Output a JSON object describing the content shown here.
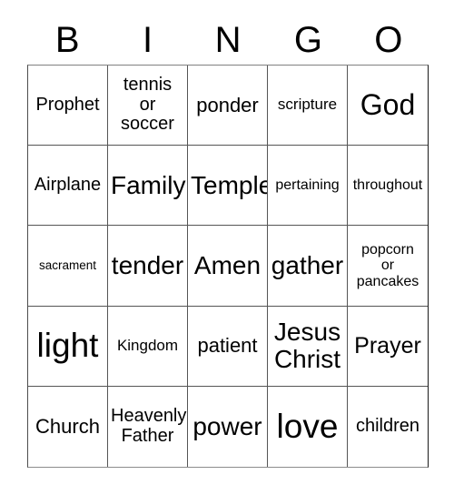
{
  "card": {
    "title_letters": [
      "B",
      "I",
      "N",
      "G",
      "O"
    ],
    "columns": 5,
    "rows": 5,
    "cells": [
      {
        "text": "Prophet",
        "size": "sz-md"
      },
      {
        "text": "tennis\nor\nsoccer",
        "size": "sz-md"
      },
      {
        "text": "ponder",
        "size": "sz-mdl"
      },
      {
        "text": "scripture",
        "size": "sz-smm"
      },
      {
        "text": "God",
        "size": "sz-xxl"
      },
      {
        "text": "Airplane",
        "size": "sz-md"
      },
      {
        "text": "Family",
        "size": "sz-xl"
      },
      {
        "text": "Temple",
        "size": "sz-xl"
      },
      {
        "text": "pertaining",
        "size": "sz-sm"
      },
      {
        "text": "throughout",
        "size": "sz-sm"
      },
      {
        "text": "sacrament",
        "size": "sz-xs"
      },
      {
        "text": "tender",
        "size": "sz-xl"
      },
      {
        "text": "Amen",
        "size": "sz-xl"
      },
      {
        "text": "gather",
        "size": "sz-xl"
      },
      {
        "text": "popcorn\nor\npancakes",
        "size": "sz-sm"
      },
      {
        "text": "light",
        "size": "sz-huge"
      },
      {
        "text": "Kingdom",
        "size": "sz-smm"
      },
      {
        "text": "patient",
        "size": "sz-mdl"
      },
      {
        "text": "Jesus\nChrist",
        "size": "sz-xl"
      },
      {
        "text": "Prayer",
        "size": "sz-lg"
      },
      {
        "text": "Church",
        "size": "sz-mdl"
      },
      {
        "text": "Heavenly\nFather",
        "size": "sz-md"
      },
      {
        "text": "power",
        "size": "sz-xl"
      },
      {
        "text": "love",
        "size": "sz-huge"
      },
      {
        "text": "children",
        "size": "sz-md"
      }
    ]
  },
  "colors": {
    "background": "#ffffff",
    "text": "#000000",
    "grid_line": "#555555"
  }
}
